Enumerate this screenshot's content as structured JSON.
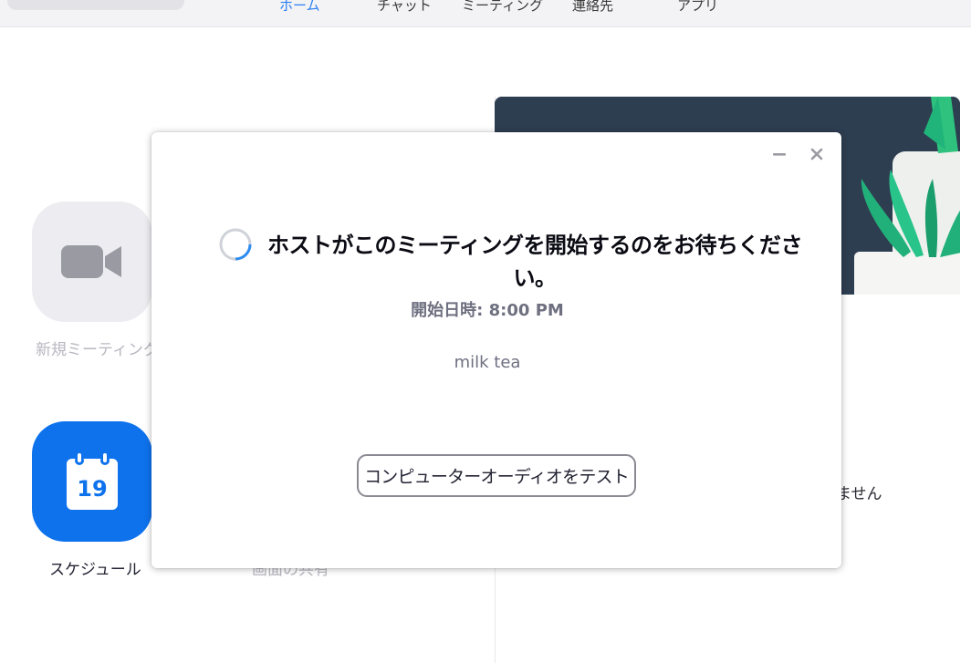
{
  "nav": {
    "tabs": [
      {
        "label": "ホーム",
        "active": true
      },
      {
        "label": "チャット"
      },
      {
        "label": "ミーティング"
      },
      {
        "label": "連絡先"
      },
      {
        "label": "アプリ"
      }
    ]
  },
  "home": {
    "new_meeting_label": "新規ミーティング",
    "schedule_label": "スケジュール",
    "calendar_day": "19",
    "share_screen_label": "画面の共有",
    "no_meetings_text": "ません"
  },
  "dialog": {
    "wait_message": "ホストがこのミーティングを開始するのをお待ちください。",
    "start_time_label": "開始日時:",
    "start_time_value": "8:00 PM",
    "meeting_topic": "milk tea",
    "test_audio_button": "コンピューターオーディオをテスト"
  },
  "icons": {
    "video": "video-camera-icon",
    "calendar": "calendar-icon",
    "spinner": "loading-spinner-icon",
    "minimize": "minimize-icon",
    "close": "close-icon"
  },
  "colors": {
    "accent_blue": "#0e72ed",
    "active_tab": "#2d7ff0",
    "hero_background": "#2e3e51",
    "plant_green": "#20b47a"
  }
}
